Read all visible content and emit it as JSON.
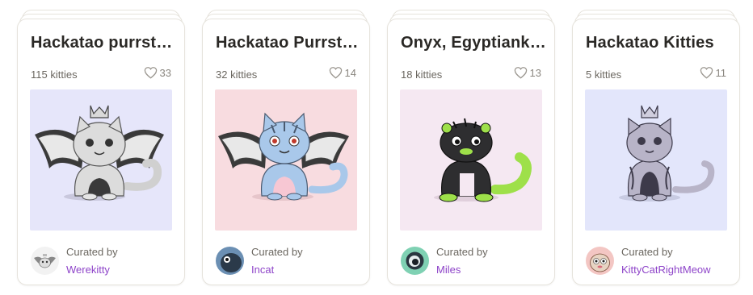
{
  "collections": [
    {
      "title": "Hackatao purrstige",
      "count": "115 kitties",
      "likes": "33",
      "curated_label": "Curated by",
      "curator": "Werekitty",
      "colors": {
        "bg": "#e6e6fa",
        "body": "#d9d9d9",
        "pattern": "grey-lace"
      }
    },
    {
      "title": "Hackatao Purrstige",
      "count": "32 kitties",
      "likes": "14",
      "curated_label": "Curated by",
      "curator": "Incat",
      "colors": {
        "bg": "#f8dce0",
        "body": "#a9c8ea",
        "pattern": "blue-stripes"
      }
    },
    {
      "title": "Onyx, Egyptiankitty",
      "count": "18 kitties",
      "likes": "13",
      "curated_label": "Curated by",
      "curator": "Miles",
      "colors": {
        "bg": "#f5e8f2",
        "body": "#2e2e30",
        "pattern": "lime-green"
      }
    },
    {
      "title": "Hackatao Kitties",
      "count": "5 kitties",
      "likes": "11",
      "curated_label": "Curated by",
      "curator": "KittyCatRightMeow",
      "colors": {
        "bg": "#e3e6fb",
        "body": "#b8b4c8",
        "pattern": "lilac-grey"
      }
    }
  ],
  "accent_link_color": "#8e44c9"
}
